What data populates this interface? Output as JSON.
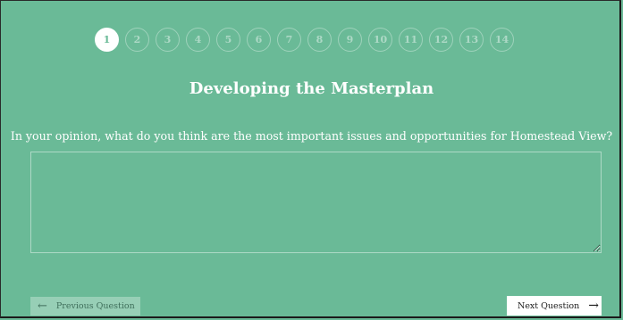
{
  "steps": {
    "items": [
      "1",
      "2",
      "3",
      "4",
      "5",
      "6",
      "7",
      "8",
      "9",
      "10",
      "11",
      "12",
      "13",
      "14"
    ],
    "active": "1"
  },
  "page": {
    "title": "Developing the Masterplan",
    "question": "In your opinion, what do you think are the most important issues and opportunities for Homestead View?"
  },
  "answer": {
    "value": "",
    "placeholder": ""
  },
  "nav": {
    "previous_label": "Previous Question",
    "previous_icon": "arrow-left-icon",
    "next_label": "Next Question",
    "next_icon": "arrow-right-icon"
  },
  "colors": {
    "background": "#6aba97",
    "active_step": "#ffffff",
    "next_button": "#ffffff"
  }
}
